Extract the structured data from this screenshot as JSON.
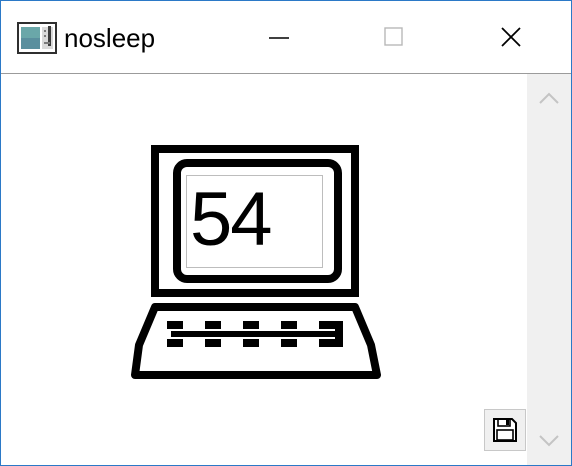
{
  "window": {
    "title": "nosleep",
    "accent_color": "#2b79c7",
    "controls": [
      "minimize-icon",
      "maximize-icon",
      "close-icon"
    ]
  },
  "display": {
    "value": "54",
    "graphic": "laptop-icon"
  },
  "toolbar": {
    "save_icon": "floppy-disk-icon"
  },
  "scrollbar": {
    "up_icon": "chevron-up-icon",
    "down_icon": "chevron-down-icon"
  }
}
